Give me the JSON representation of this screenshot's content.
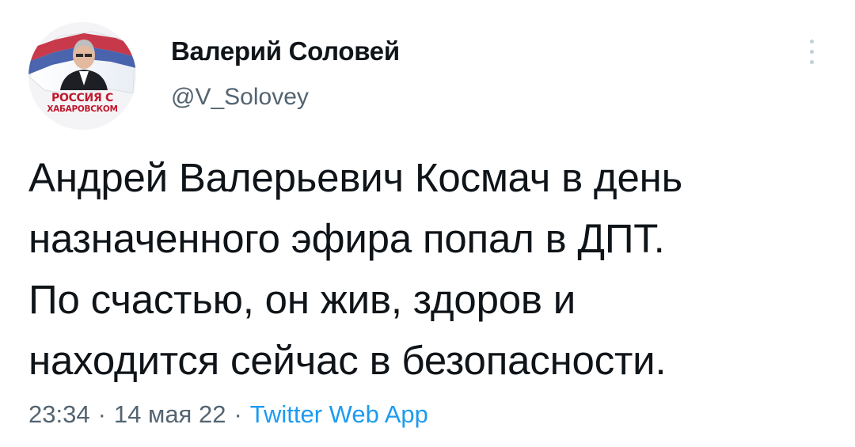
{
  "author": {
    "display_name": "Валерий Соловей",
    "handle": "@V_Solovey",
    "avatar_caption_line1": "РОССИЯ С",
    "avatar_caption_line2": "ХАБАРОВСКОМ"
  },
  "more_icon": "more-vertical-icon",
  "tweet": {
    "text_lines": [
      "Андрей Валерьевич Космач в день",
      "назначенного эфира попал в ДПТ.",
      "По счастью, он жив, здоров и",
      "находится сейчас в безопасности."
    ]
  },
  "meta": {
    "time": "23:34",
    "separator": "·",
    "date": "14 мая 22",
    "source": "Twitter Web App"
  },
  "colors": {
    "text_primary": "#0f1419",
    "text_secondary": "#536471",
    "link": "#1d9bf0",
    "avatar_caption": "#c0182c"
  }
}
